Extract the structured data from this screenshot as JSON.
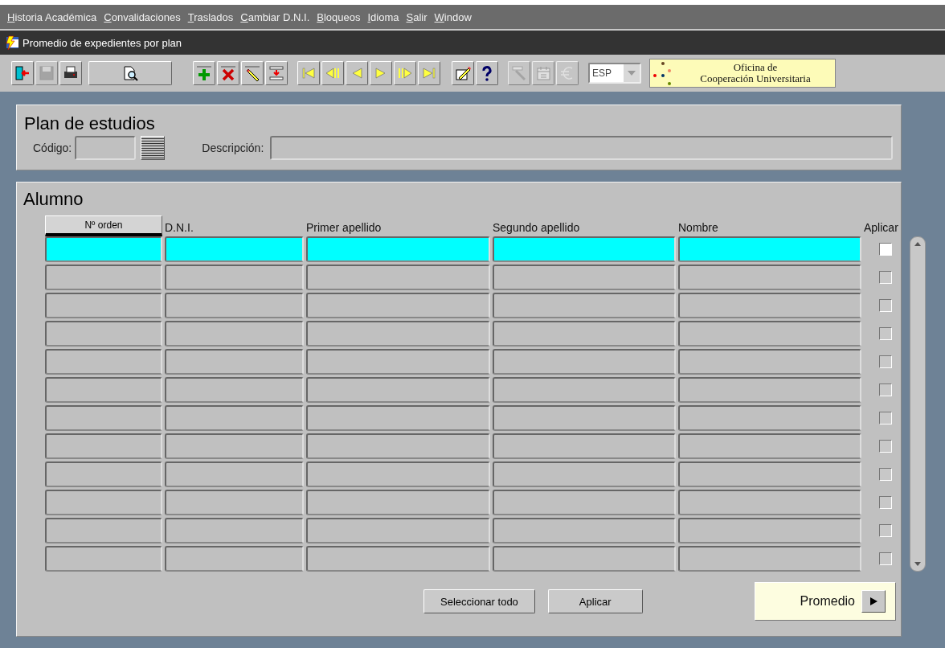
{
  "menu": [
    "Historia Académica",
    "Convalidaciones",
    "Traslados",
    "Cambiar D.N.I.",
    "Bloqueos",
    "Idioma",
    "Salir",
    "Window"
  ],
  "window": {
    "title": "Promedio de expedientes por plan"
  },
  "toolbar": [
    {
      "kind": "exit",
      "disabled": false
    },
    {
      "kind": "save",
      "disabled": true
    },
    {
      "kind": "print",
      "disabled": false
    },
    {
      "kind": "query",
      "disabled": false
    },
    {
      "kind": "insert",
      "disabled": false
    },
    {
      "kind": "delete",
      "disabled": false
    },
    {
      "kind": "edit",
      "disabled": false
    },
    {
      "kind": "duplicate",
      "disabled": false
    },
    {
      "kind": "first",
      "disabled": false
    },
    {
      "kind": "prevset",
      "disabled": false
    },
    {
      "kind": "prev",
      "disabled": false
    },
    {
      "kind": "next",
      "disabled": false
    },
    {
      "kind": "nextset",
      "disabled": false
    },
    {
      "kind": "last",
      "disabled": false
    },
    {
      "kind": "notes",
      "disabled": false
    },
    {
      "kind": "help",
      "disabled": false
    },
    {
      "kind": "tools",
      "disabled": true
    },
    {
      "kind": "calendar",
      "disabled": true
    },
    {
      "kind": "euro",
      "disabled": true
    }
  ],
  "language": {
    "value": "ESP"
  },
  "logo": {
    "line_1": "Oficina de",
    "line_2": "Cooperación Universitaria"
  },
  "plan": {
    "title": "Plan de estudios",
    "code_label": "Código:",
    "description_label": "Descripción:"
  },
  "alumno": {
    "title": "Alumno",
    "columns": [
      {
        "label": "Nº orden",
        "kind": "button"
      },
      {
        "label": "D.N.I.",
        "kind": "label"
      },
      {
        "label": "Primer apellido",
        "kind": "label"
      },
      {
        "label": "Segundo apellido",
        "kind": "label"
      },
      {
        "label": "Nombre",
        "kind": "label"
      }
    ],
    "check_label": "Aplicar",
    "rows": [
      {
        "selected": true,
        "checked": false
      },
      {
        "selected": false,
        "checked": false
      },
      {
        "selected": false,
        "checked": false
      },
      {
        "selected": false,
        "checked": false
      },
      {
        "selected": false,
        "checked": false
      },
      {
        "selected": false,
        "checked": false
      },
      {
        "selected": false,
        "checked": false
      },
      {
        "selected": false,
        "checked": false
      },
      {
        "selected": false,
        "checked": false
      },
      {
        "selected": false,
        "checked": false
      },
      {
        "selected": false,
        "checked": false
      },
      {
        "selected": false,
        "checked": false
      }
    ],
    "buttons": [
      "Seleccionar todo",
      "Aplicar"
    ],
    "next_button": "Promedio"
  }
}
